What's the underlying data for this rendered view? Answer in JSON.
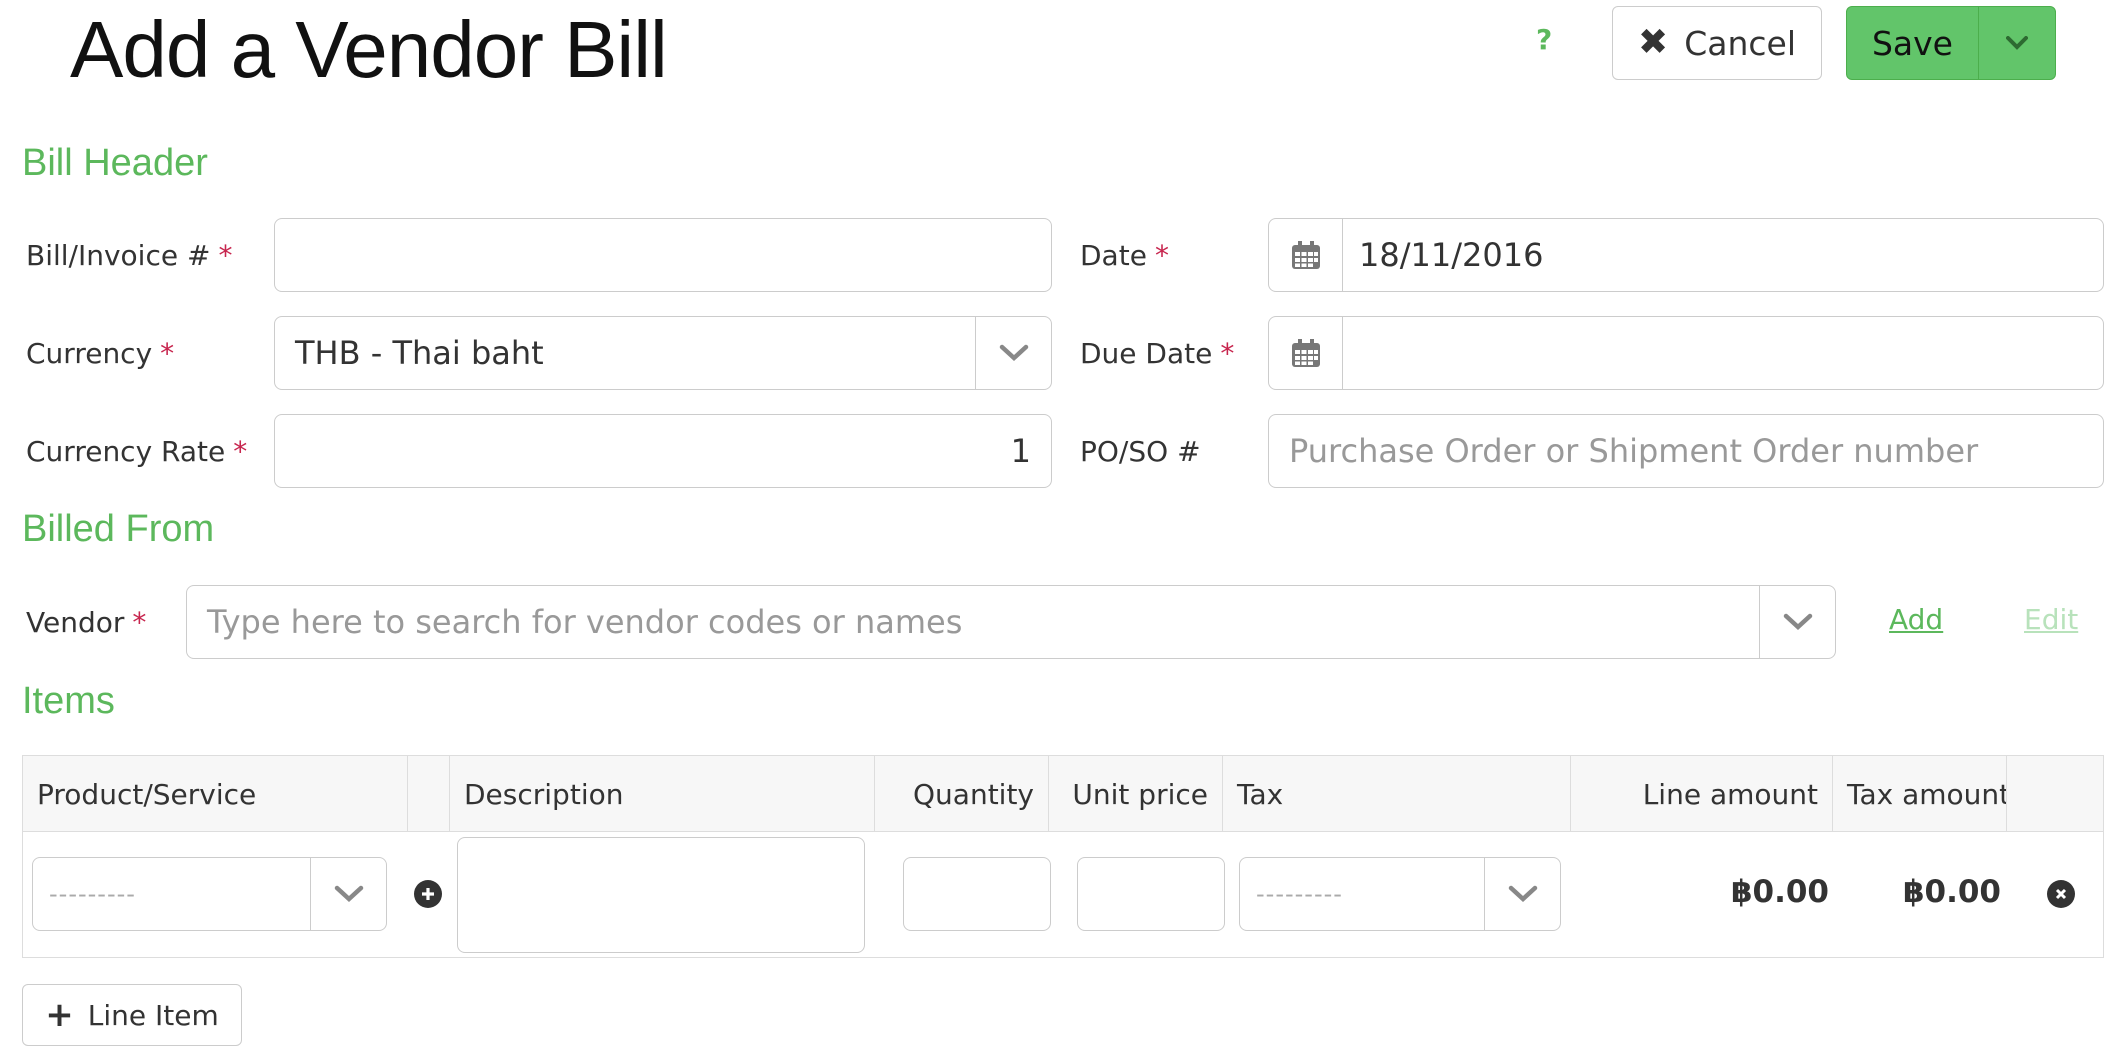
{
  "page": {
    "title": "Add a Vendor Bill",
    "help": "?"
  },
  "actions": {
    "cancel_label": "Cancel",
    "save_label": "Save"
  },
  "bill_header": {
    "heading": "Bill Header",
    "bill_invoice_label": "Bill/Invoice #",
    "bill_invoice_value": "",
    "date_label": "Date",
    "date_value": "18/11/2016",
    "currency_label": "Currency",
    "currency_value": "THB - Thai baht",
    "due_date_label": "Due Date",
    "due_date_value": "",
    "currency_rate_label": "Currency Rate",
    "currency_rate_value": "1",
    "po_so_label": "PO/SO #",
    "po_so_placeholder": "Purchase Order or Shipment Order number",
    "required_marker": "*"
  },
  "billed_from": {
    "heading": "Billed From",
    "vendor_label": "Vendor",
    "vendor_placeholder": "Type here to search for vendor codes or names",
    "add_link": "Add",
    "edit_link": "Edit"
  },
  "items": {
    "heading": "Items",
    "columns": {
      "product": "Product/Service",
      "description": "Description",
      "quantity": "Quantity",
      "unit_price": "Unit price",
      "tax": "Tax",
      "line_amount": "Line amount",
      "tax_amount": "Tax amount"
    },
    "rows": [
      {
        "product": "---------",
        "tax": "---------",
        "line_amount": "฿0.00",
        "tax_amount": "฿0.00"
      }
    ],
    "add_line_label": "Line Item"
  },
  "colors": {
    "accent": "#5cb85c",
    "required": "#c7254e"
  }
}
